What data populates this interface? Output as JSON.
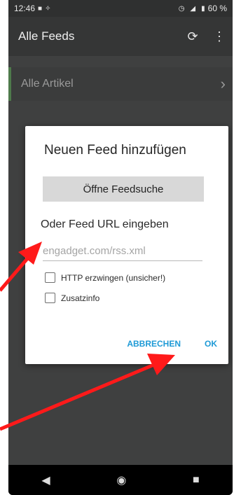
{
  "status_bar": {
    "time": "12:46",
    "battery": "60 %",
    "icons": [
      "notification-icon",
      "app-icon",
      "alarm-icon",
      "signal-icon",
      "battery-icon"
    ]
  },
  "app_bar": {
    "title": "Alle Feeds",
    "refresh_icon": "refresh-icon",
    "menu_icon": "more-vert-icon"
  },
  "list": {
    "items": [
      {
        "label": "Alle Artikel"
      }
    ]
  },
  "dialog": {
    "title": "Neuen Feed hinzufügen",
    "search_button": "Öffne Feedsuche",
    "url_label": "Oder Feed URL eingeben",
    "url_placeholder": "engadget.com/rss.xml",
    "url_value": "",
    "checkboxes": [
      {
        "label": "HTTP erzwingen (unsicher!)",
        "checked": false
      },
      {
        "label": "Zusatzinfo",
        "checked": false
      }
    ],
    "cancel": "ABBRECHEN",
    "ok": "OK"
  },
  "nav_bar": {
    "icons": [
      "back-icon",
      "home-icon",
      "recents-icon"
    ]
  },
  "colors": {
    "background_dim": "#3f4040",
    "accent": "#1e9ad6",
    "annotation_arrow": "#ff1a1a"
  }
}
